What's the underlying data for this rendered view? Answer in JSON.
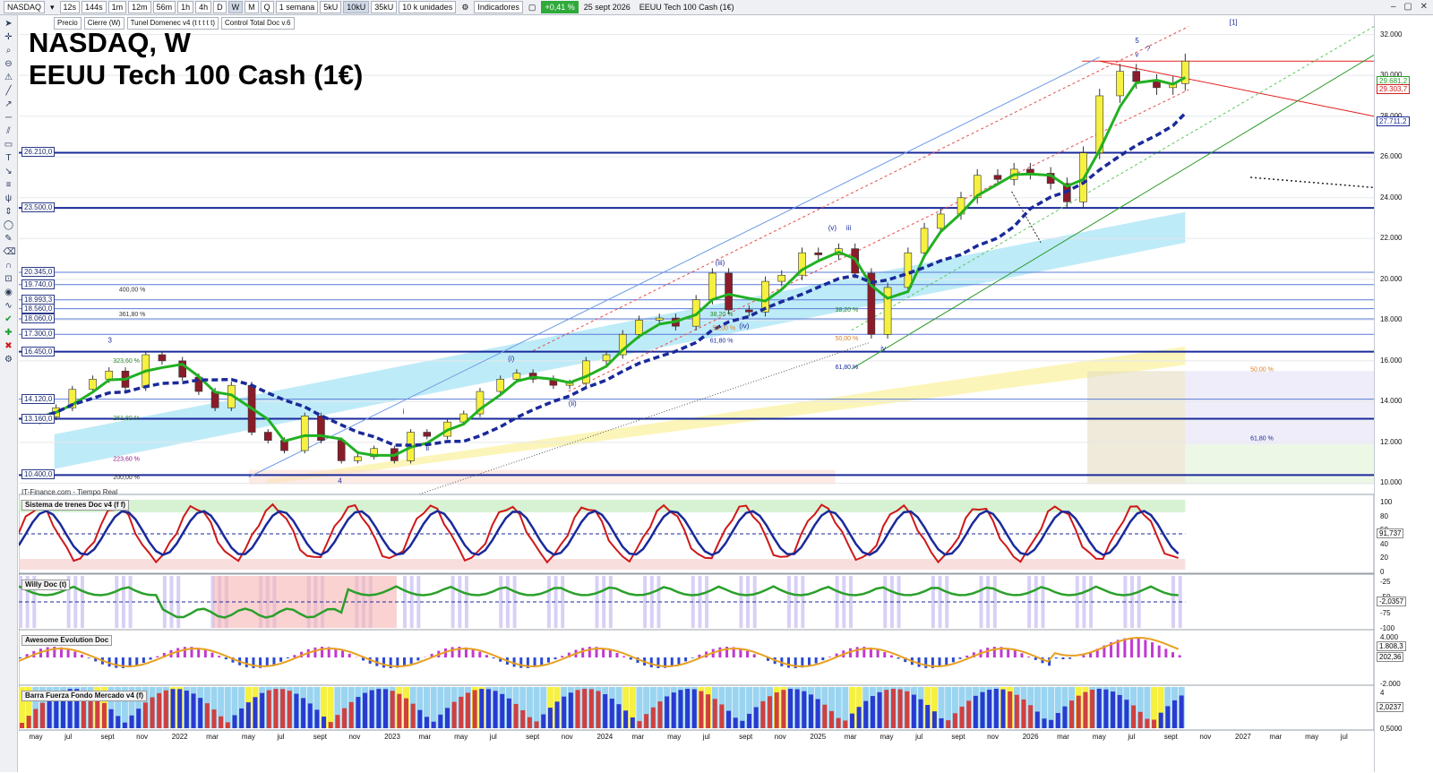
{
  "toolbar": {
    "symbol": "NASDAQ",
    "intervals": [
      "12s",
      "144s",
      "1m",
      "12m",
      "56m",
      "1h",
      "4h",
      "D",
      "W",
      "M",
      "Q"
    ],
    "selected_interval": "W",
    "period": "1 semana",
    "units": [
      "5kU",
      "10kU",
      "35kU"
    ],
    "selected_unit": "10kU",
    "units_dropdown": "10 k unidades",
    "indicators": "Indicadores",
    "change": "+0,41 %",
    "date": "25 sept 2026",
    "instrument": "EEUU Tech 100 Cash (1€)"
  },
  "legend_tags": [
    "Precio",
    "Cierre (W)",
    "Tunel Domenec v4 (t t t t t)",
    "Control Total Doc v.6"
  ],
  "title_line1": "NASDAQ, W",
  "title_line2": "EEUU Tech 100 Cash (1€)",
  "watermark": "IT-Finance.com - Tiempo Real",
  "colors": {
    "up": "#f6f040",
    "down": "#8a1c2a",
    "fast_ma": "#22b022",
    "slow_ma": "#1a2a9a",
    "horizontal": "#1a2a9a",
    "red_line": "#e52020"
  },
  "price_axis": {
    "ticks": [
      "32.000",
      "30.000",
      "28.000",
      "26.000",
      "24.000",
      "22.000",
      "20.000",
      "18.000",
      "16.000",
      "14.000",
      "12.000",
      "10.000"
    ],
    "last_labels": [
      "29.681,2",
      "29.303,7",
      "27.711,2"
    ]
  },
  "level_labels": [
    "26.210,0",
    "23.500,0",
    "20.345,0",
    "19.740,0",
    "18.993,3",
    "18.560,0",
    "18.060,0",
    "17.300,0",
    "16.450,0",
    "14.120,0",
    "13.160,0",
    "10.400,0"
  ],
  "fib_labels": [
    "400,00 %",
    "361,80 %",
    "323,60 %",
    "261,80 %",
    "223,60 %",
    "200,00 %",
    "38,20 %",
    "50,00 %",
    "61,80 %",
    "38,20 %",
    "50,00 %",
    "61,80 %",
    "50,00 %",
    "61,80 %"
  ],
  "wave_labels": [
    "3",
    "4",
    "i",
    "ii",
    "(i)",
    "(ii)",
    "(iii)",
    "(iv)",
    "(v)",
    "iii",
    "iv",
    "v",
    "5",
    "?",
    "[1]"
  ],
  "panels": [
    {
      "name": "Sistema de trenes Doc v4 (f f)",
      "ticks": [
        "100",
        "80",
        "50",
        "40",
        "20",
        "0"
      ],
      "value": "91,737"
    },
    {
      "name": "Willy Doc (t)",
      "ticks": [
        "-25",
        "-50",
        "-75",
        "-100"
      ],
      "value": "-2,0357"
    },
    {
      "name": "Awesome Evolution Doc",
      "ticks": [
        "4.000",
        "-2.000"
      ],
      "value": "202,36",
      "value2": "1.808,3"
    },
    {
      "name": "Barra Fuerza Fondo Mercado v4 (f)",
      "ticks": [
        "4",
        "0,5000"
      ],
      "value": "2,0237"
    }
  ],
  "time_axis": [
    "may",
    "jul",
    "sept",
    "nov",
    "2022",
    "mar",
    "may",
    "jul",
    "sept",
    "nov",
    "2023",
    "mar",
    "may",
    "jul",
    "sept",
    "nov",
    "2024",
    "mar",
    "may",
    "jul",
    "sept",
    "nov",
    "2025",
    "mar",
    "may",
    "jul",
    "sept",
    "nov",
    "2026",
    "mar",
    "may",
    "jul",
    "sept",
    "nov",
    "2027",
    "mar",
    "may",
    "jul"
  ],
  "chart_data": {
    "type": "candlestick",
    "title": "NASDAQ, W",
    "subtitle": "EEUU Tech 100 Cash (1€)",
    "ylim": [
      9800,
      32600
    ],
    "x_range": [
      "2021-04",
      "2027-08"
    ],
    "close_series": [
      [
        "2021-05-07",
        13250
      ],
      [
        "2021-06-04",
        13700
      ],
      [
        "2021-07-02",
        14600
      ],
      [
        "2021-08-06",
        15100
      ],
      [
        "2021-09-03",
        15500
      ],
      [
        "2021-10-01",
        14700
      ],
      [
        "2021-11-05",
        16300
      ],
      [
        "2021-12-03",
        16000
      ],
      [
        "2022-01-07",
        15200
      ],
      [
        "2022-02-04",
        14500
      ],
      [
        "2022-03-04",
        13700
      ],
      [
        "2022-04-01",
        14800
      ],
      [
        "2022-05-06",
        12500
      ],
      [
        "2022-06-03",
        12100
      ],
      [
        "2022-07-01",
        11600
      ],
      [
        "2022-08-05",
        13300
      ],
      [
        "2022-09-02",
        12100
      ],
      [
        "2022-10-07",
        11100
      ],
      [
        "2022-11-04",
        11300
      ],
      [
        "2022-12-02",
        11700
      ],
      [
        "2023-01-06",
        11100
      ],
      [
        "2023-02-03",
        12500
      ],
      [
        "2023-03-03",
        12300
      ],
      [
        "2023-04-07",
        13000
      ],
      [
        "2023-05-05",
        13400
      ],
      [
        "2023-06-02",
        14500
      ],
      [
        "2023-07-07",
        15100
      ],
      [
        "2023-08-04",
        15400
      ],
      [
        "2023-09-01",
        15100
      ],
      [
        "2023-10-06",
        14800
      ],
      [
        "2023-11-03",
        14900
      ],
      [
        "2023-12-01",
        16000
      ],
      [
        "2024-01-05",
        16300
      ],
      [
        "2024-02-02",
        17300
      ],
      [
        "2024-03-01",
        18000
      ],
      [
        "2024-04-05",
        18100
      ],
      [
        "2024-05-03",
        17700
      ],
      [
        "2024-06-07",
        19000
      ],
      [
        "2024-07-05",
        20300
      ],
      [
        "2024-08-02",
        18500
      ],
      [
        "2024-09-06",
        18400
      ],
      [
        "2024-10-04",
        19900
      ],
      [
        "2024-11-01",
        20200
      ],
      [
        "2024-12-06",
        21300
      ],
      [
        "2025-01-03",
        21200
      ],
      [
        "2025-02-07",
        21500
      ],
      [
        "2025-03-07",
        20300
      ],
      [
        "2025-04-04",
        17300
      ],
      [
        "2025-05-02",
        19600
      ],
      [
        "2025-06-06",
        21300
      ],
      [
        "2025-07-04",
        22500
      ],
      [
        "2025-08-01",
        23200
      ],
      [
        "2025-09-05",
        24000
      ],
      [
        "2025-10-03",
        25100
      ],
      [
        "2025-11-07",
        24900
      ],
      [
        "2025-12-05",
        25400
      ],
      [
        "2026-01-02",
        25200
      ],
      [
        "2026-02-06",
        24700
      ],
      [
        "2026-03-06",
        23800
      ],
      [
        "2026-04-03",
        26200
      ],
      [
        "2026-05-01",
        29000
      ],
      [
        "2026-06-05",
        30200
      ],
      [
        "2026-07-03",
        29700
      ],
      [
        "2026-08-07",
        29400
      ],
      [
        "2026-09-04",
        29600
      ],
      [
        "2026-09-25",
        30700
      ]
    ],
    "horizontal_levels": [
      26210,
      23500,
      20345,
      19740,
      18993.3,
      18560,
      18060,
      17300,
      16450,
      14120,
      13160,
      10400
    ],
    "last_values": {
      "price": 29681.2,
      "fast_ma": 29303.7,
      "slow_ma": 27711.2
    }
  }
}
